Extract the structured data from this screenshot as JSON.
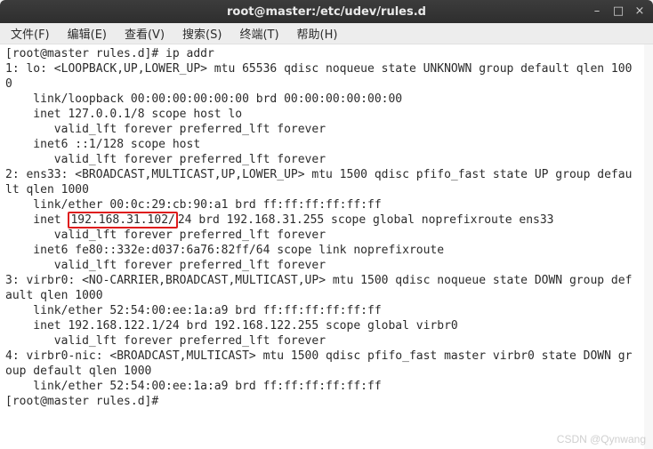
{
  "window": {
    "title": "root@master:/etc/udev/rules.d",
    "controls": {
      "minimize": "–",
      "maximize": "□",
      "close": "×"
    }
  },
  "menubar": {
    "file": "文件(F)",
    "edit": "编辑(E)",
    "view": "查看(V)",
    "search": "搜索(S)",
    "terminal": "终端(T)",
    "help": "帮助(H)"
  },
  "terminal": {
    "prompt1": "[root@master rules.d]# ",
    "command1": "ip addr",
    "line_lo_hdr": "1: lo: <LOOPBACK,UP,LOWER_UP> mtu 65536 qdisc noqueue state UNKNOWN group default qlen 1000",
    "line_lo_link": "    link/loopback 00:00:00:00:00:00 brd 00:00:00:00:00:00",
    "line_lo_inet": "    inet 127.0.0.1/8 scope host lo",
    "line_lo_valid": "       valid_lft forever preferred_lft forever",
    "line_lo_inet6": "    inet6 ::1/128 scope host",
    "line_lo_valid6": "       valid_lft forever preferred_lft forever",
    "line_ens_hdr": "2: ens33: <BROADCAST,MULTICAST,UP,LOWER_UP> mtu 1500 qdisc pfifo_fast state UP group default qlen 1000",
    "line_ens_link_a": "    link/ether 00:0c:29:",
    "line_ens_link_b": "cb:90:a1 brd ff:ff:ff:ff:ff:ff",
    "line_ens_inet_a": "    inet ",
    "line_ens_inet_hl": "192.168.31.102/",
    "line_ens_inet_b": "24 brd 192.168.31.255 scope global noprefixroute ens33",
    "line_ens_valid": "       valid_lft forever preferred_lft forever",
    "line_ens_inet6": "    inet6 fe80::332e:d037:6a76:82ff/64 scope link noprefixroute",
    "line_ens_valid6": "       valid_lft forever preferred_lft forever",
    "line_vb_hdr": "3: virbr0: <NO-CARRIER,BROADCAST,MULTICAST,UP> mtu 1500 qdisc noqueue state DOWN group default qlen 1000",
    "line_vb_link": "    link/ether 52:54:00:ee:1a:a9 brd ff:ff:ff:ff:ff:ff",
    "line_vb_inet": "    inet 192.168.122.1/24 brd 192.168.122.255 scope global virbr0",
    "line_vb_valid": "       valid_lft forever preferred_lft forever",
    "line_vbn_hdr": "4: virbr0-nic: <BROADCAST,MULTICAST> mtu 1500 qdisc pfifo_fast master virbr0 state DOWN group default qlen 1000",
    "line_vbn_link": "    link/ether 52:54:00:ee:1a:a9 brd ff:ff:ff:ff:ff:ff",
    "prompt2": "[root@master rules.d]# "
  },
  "watermark": "CSDN @Qynwang"
}
